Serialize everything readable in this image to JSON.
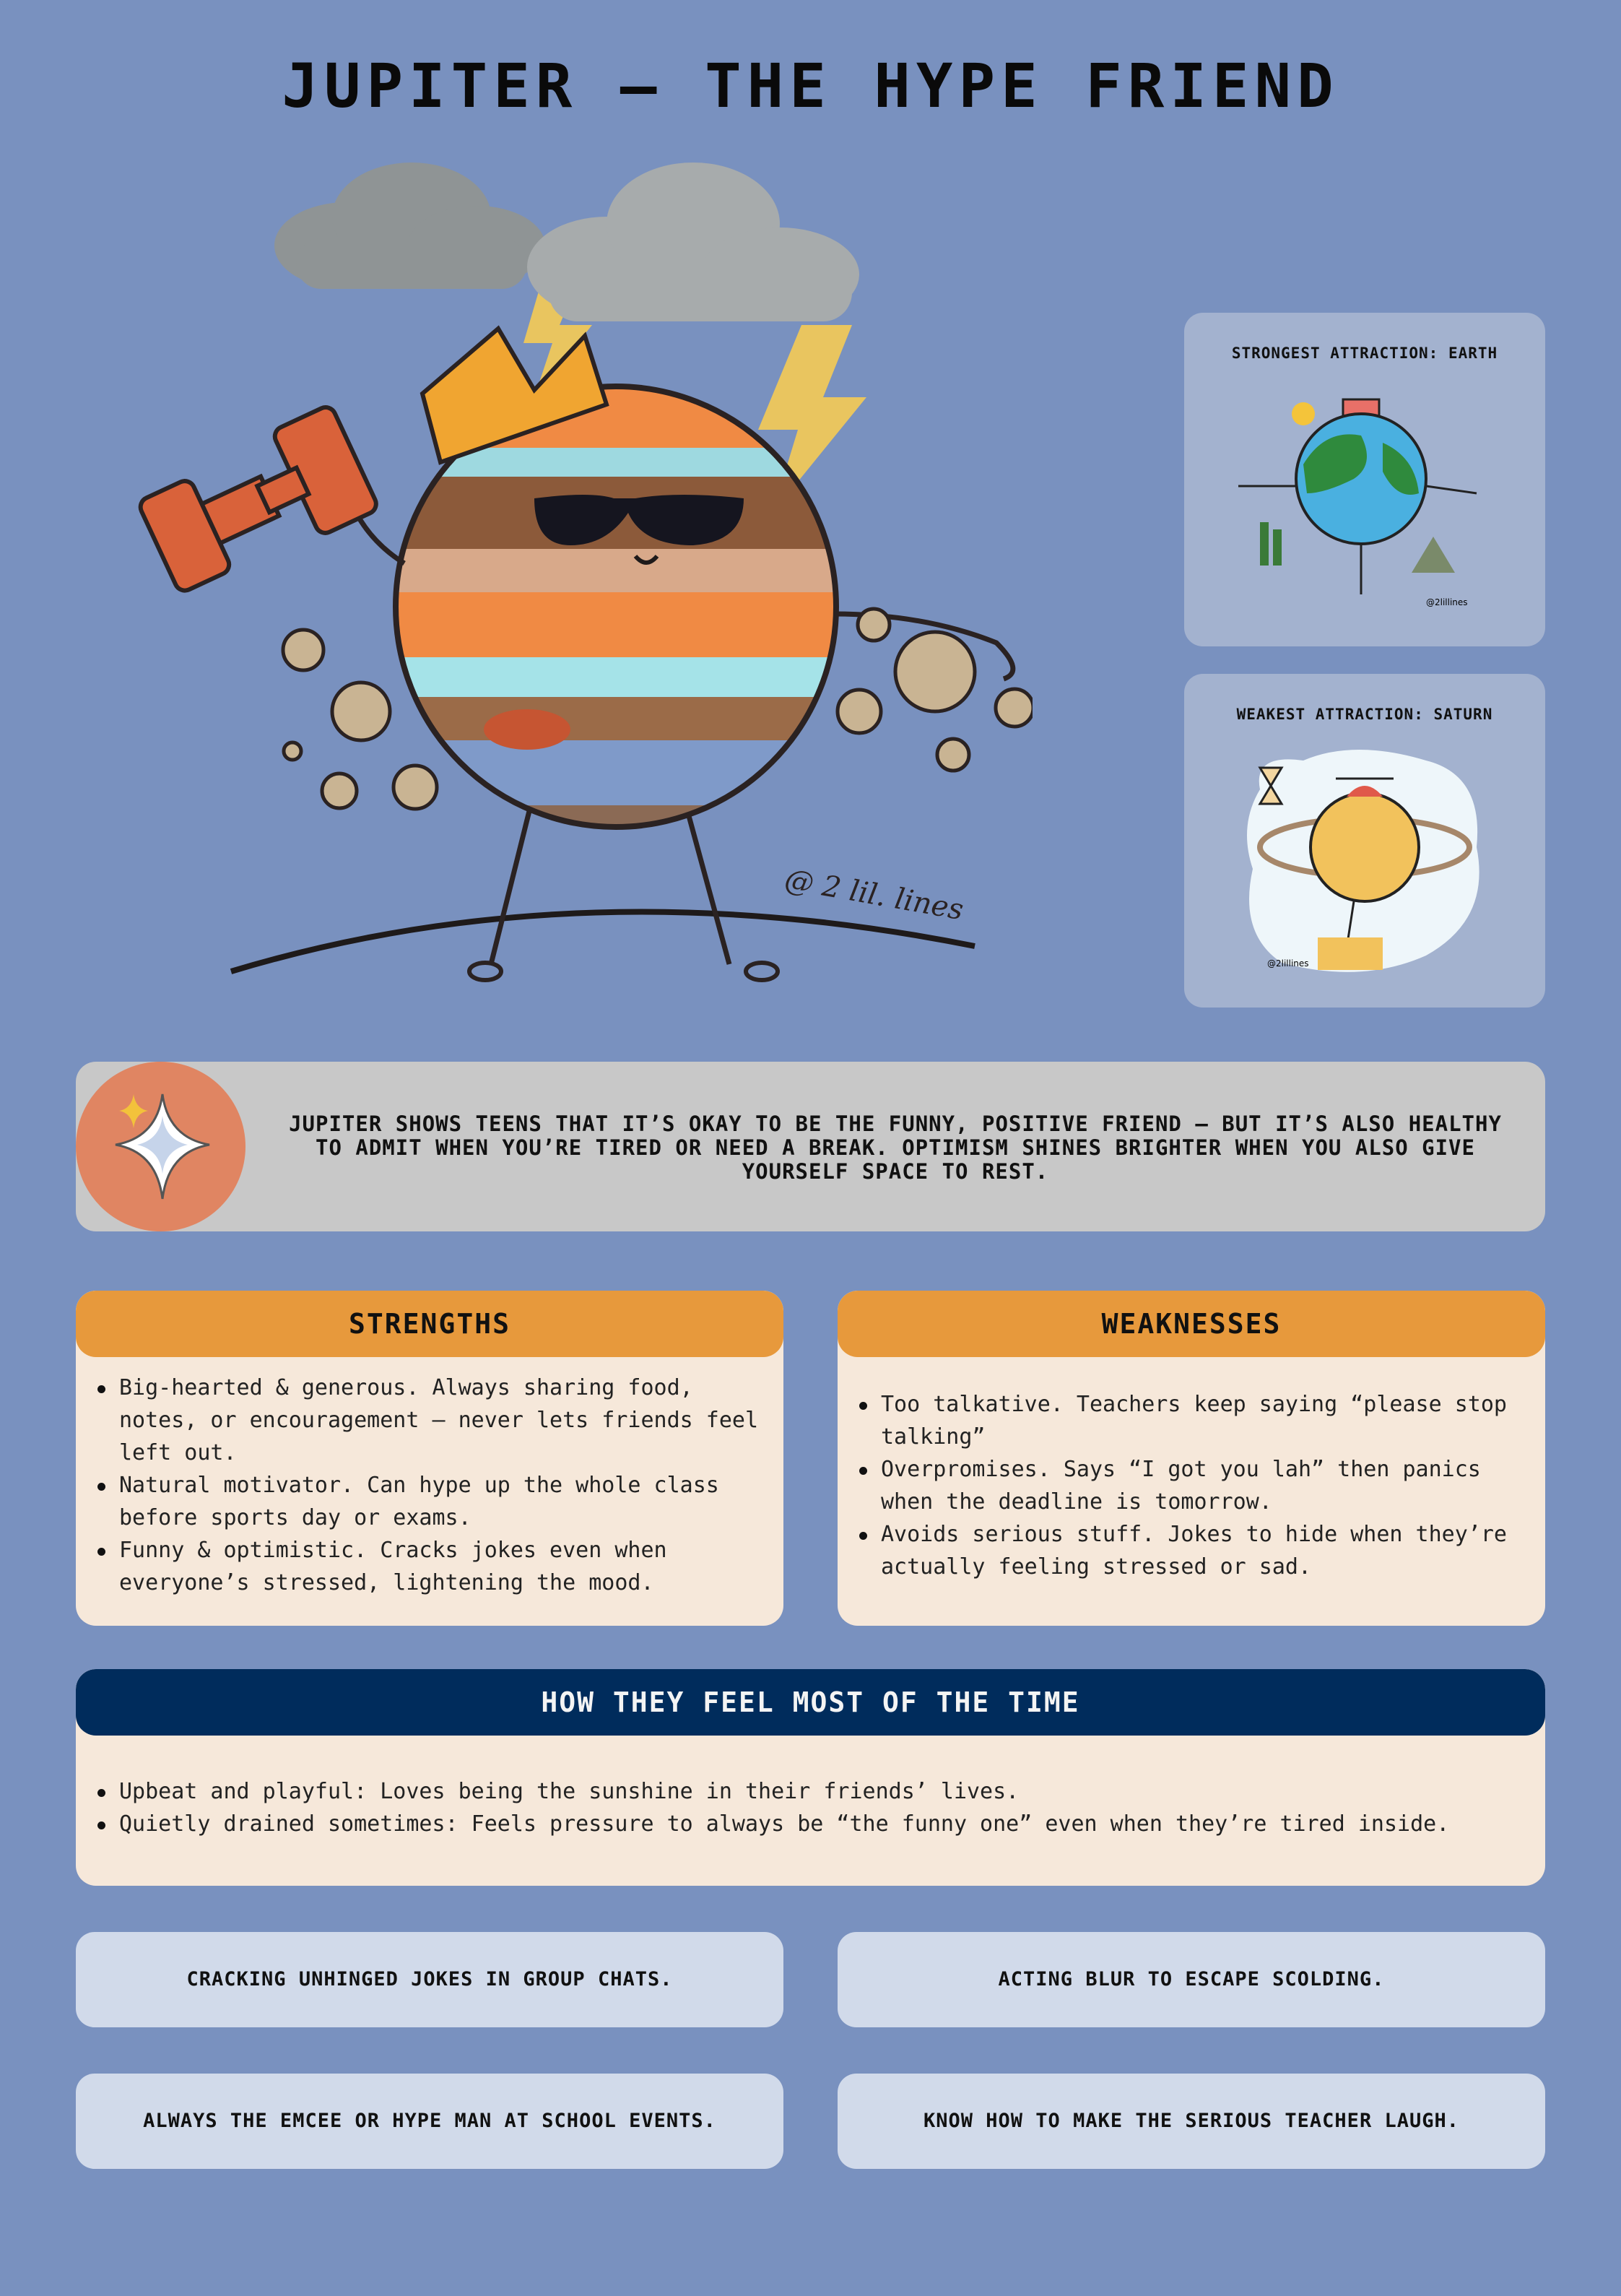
{
  "title": "JUPITER – THE HYPE FRIEND",
  "hero": {
    "signature": "@ 2 lil. lines"
  },
  "attractions": {
    "strongest": {
      "label": "STRONGEST ATTRACTION: EARTH",
      "signature": "@2lillines"
    },
    "weakest": {
      "label": "WEAKEST ATTRACTION: SATURN",
      "signature": "@2lillines"
    }
  },
  "quote": {
    "icon": "sparkle-icon",
    "text": "JUPITER SHOWS TEENS THAT IT’S OKAY TO BE THE FUNNY, POSITIVE FRIEND – BUT IT’S ALSO HEALTHY TO ADMIT WHEN YOU’RE TIRED OR NEED A BREAK. OPTIMISM SHINES BRIGHTER WHEN YOU ALSO GIVE YOURSELF SPACE TO REST."
  },
  "strengths": {
    "heading": "STRENGTHS",
    "items": [
      "Big-hearted & generous. Always sharing food, notes, or encouragement – never lets friends feel left out.",
      "Natural motivator. Can hype up the whole class before sports day or exams.",
      "Funny & optimistic. Cracks jokes even when everyone’s stressed, lightening the mood."
    ]
  },
  "weaknesses": {
    "heading": "WEAKNESSES",
    "items": [
      "Too talkative. Teachers keep saying “please stop talking”",
      "Overpromises. Says “I got you lah” then panics when the deadline is tomorrow.",
      "Avoids serious stuff. Jokes to hide when they’re actually feeling stressed or sad."
    ]
  },
  "feelings": {
    "heading": "HOW THEY FEEL MOST OF THE TIME",
    "items": [
      "Upbeat and playful: Loves being the sunshine in their friends’ lives.",
      "Quietly drained sometimes: Feels pressure to always be “the funny one” even when they’re tired inside."
    ]
  },
  "traits": [
    "CRACKING UNHINGED JOKES IN GROUP CHATS.",
    "ACTING BLUR TO ESCAPE SCOLDING.",
    "ALWAYS THE EMCEE OR HYPE MAN AT SCHOOL EVENTS.",
    "KNOW HOW TO MAKE THE SERIOUS TEACHER LAUGH."
  ],
  "colors": {
    "background": "#7991bf",
    "panel_header": "#e7993c",
    "panel_body": "#f6e8da",
    "feel_header": "#002c5c",
    "chip": "#d1daea",
    "quote_circle": "#e08562",
    "quote_box": "#c8c8c8"
  }
}
